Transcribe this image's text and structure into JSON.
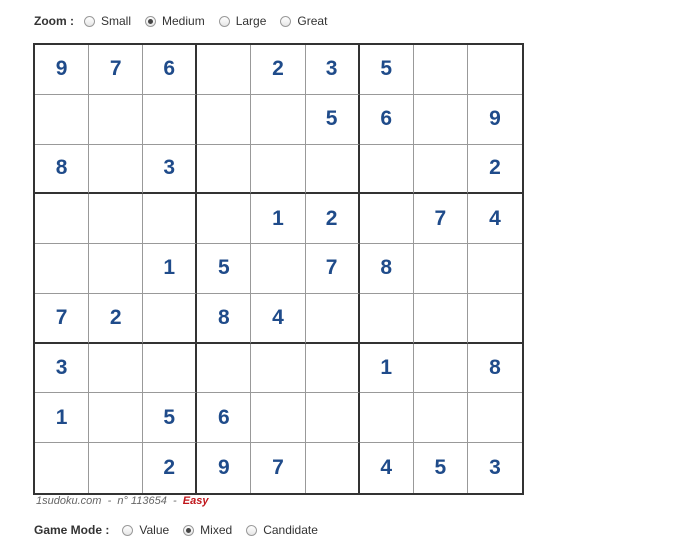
{
  "zoom": {
    "label": "Zoom :",
    "options": [
      {
        "label": "Small",
        "checked": false
      },
      {
        "label": "Medium",
        "checked": true
      },
      {
        "label": "Large",
        "checked": false
      },
      {
        "label": "Great",
        "checked": false
      }
    ]
  },
  "grid": [
    [
      "9",
      "7",
      "6",
      "",
      "2",
      "3",
      "5",
      "",
      ""
    ],
    [
      "",
      "",
      "",
      "",
      "",
      "5",
      "6",
      "",
      "9"
    ],
    [
      "8",
      "",
      "3",
      "",
      "",
      "",
      "",
      "",
      "2"
    ],
    [
      "",
      "",
      "",
      "",
      "1",
      "2",
      "",
      "7",
      "4"
    ],
    [
      "",
      "",
      "1",
      "5",
      "",
      "7",
      "8",
      "",
      ""
    ],
    [
      "7",
      "2",
      "",
      "8",
      "4",
      "",
      "",
      "",
      ""
    ],
    [
      "3",
      "",
      "",
      "",
      "",
      "",
      "1",
      "",
      "8"
    ],
    [
      "1",
      "",
      "5",
      "6",
      "",
      "",
      "",
      "",
      ""
    ],
    [
      "",
      "",
      "2",
      "9",
      "7",
      "",
      "4",
      "5",
      "3"
    ]
  ],
  "colors": {
    "given_digit": "#1f4b8a",
    "level": "#c0161b"
  },
  "credit": {
    "site": "1sudoku.com",
    "separator": "-",
    "number": "n° 113654",
    "level": "Easy"
  },
  "game_mode": {
    "label": "Game Mode :",
    "options": [
      {
        "label": "Value",
        "checked": false
      },
      {
        "label": "Mixed",
        "checked": true
      },
      {
        "label": "Candidate",
        "checked": false
      }
    ]
  }
}
